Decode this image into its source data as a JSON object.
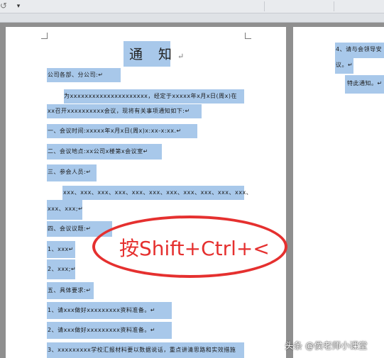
{
  "toolbar": {
    "undo_icon": "undo-icon",
    "customize_icon": "dropdown-arrow-icon",
    "customize_glyph": "▾",
    "undo_glyph": "↺"
  },
  "document": {
    "title": "通 知",
    "paragraph_mark": "↵",
    "lines": [
      "公司各部、分公司:↵",
      "为xxxxxxxxxxxxxxxxxxxxx，经定于xxxxx年x月x日(周x)在",
      "xx召开xxxxxxxxxx会议，现将有关事项通知如下:↵",
      "一、会议时间:xxxxx年x月x日(周x)x:xx-x:xx.↵",
      "二、会议地点:xx公司x楼第x会议室↵",
      "三、参会人员:↵",
      "xxx、xxx、xxx、xxx、xxx、xxx、xxx、xxx、xxx、xxx、xxx、",
      "xxx、xxx;↵",
      "四、会议议题:↵",
      "1、xxx↵",
      "2、xxx;↵",
      "五、具体要求:↵",
      "1、请xxx做好xxxxxxxxx资料准备。↵",
      "2、请xxx做好xxxxxxxxx资料准备。↵",
      "3、xxxxxxxxx学校汇报材料要以数据说话，重点讲清思路和实效措施"
    ],
    "right_page_lines": [
      "4、请与会领导安",
      "议。↵",
      "特此通知。↵"
    ]
  },
  "callout": {
    "text": "按Shift+Ctrl+<",
    "color": "#e5302f"
  },
  "watermark": {
    "text": "头条 @侯老师小课堂"
  }
}
